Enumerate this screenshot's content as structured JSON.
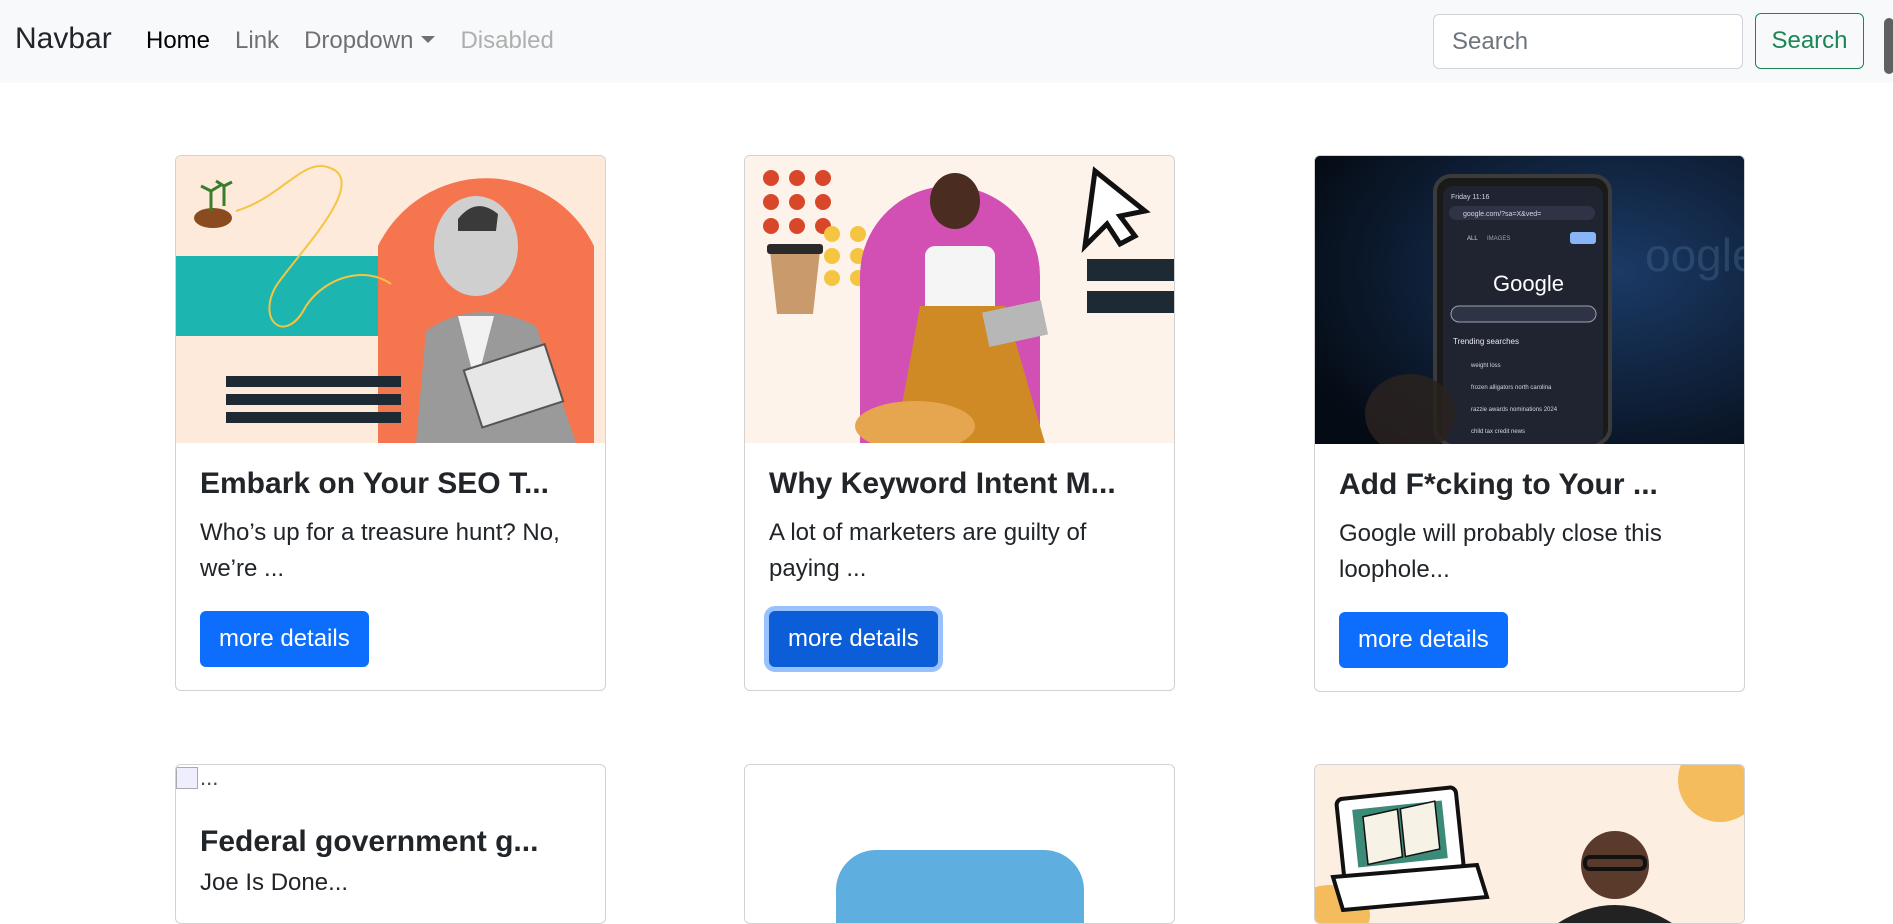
{
  "navbar": {
    "brand": "Navbar",
    "links": [
      {
        "label": "Home",
        "state": "active"
      },
      {
        "label": "Link",
        "state": "normal"
      },
      {
        "label": "Dropdown",
        "state": "dropdown"
      },
      {
        "label": "Disabled",
        "state": "disabled"
      }
    ],
    "search_placeholder": "Search",
    "search_button": "Search"
  },
  "cards": [
    {
      "title": "Embark on Your SEO T...",
      "text": "Who’s up for a treasure hunt? No, we’re ...",
      "button": "more details"
    },
    {
      "title": "Why Keyword Intent M...",
      "text": "A lot of marketers are guilty of paying ...",
      "button": "more details"
    },
    {
      "title": "Add F*cking to Your ...",
      "text": "Google will probably close this loophole...",
      "button": "more details"
    },
    {
      "title": "Federal government g...",
      "text": "Joe Is Done...",
      "image_alt": "..."
    }
  ],
  "phone_screen": {
    "url": "google.com/?sa=X&ved=",
    "logo": "Google",
    "tabs": [
      "ALL",
      "IMAGES"
    ],
    "trending_heading": "Trending searches",
    "trending": [
      "weight loss",
      "frozen alligators north carolina",
      "razzie awards nominations 2024",
      "child tax credit news"
    ],
    "status_time": "Friday 11:16"
  },
  "colors": {
    "primary": "#0d6efd",
    "success": "#198754",
    "navbar_bg": "#f8f9fa"
  }
}
